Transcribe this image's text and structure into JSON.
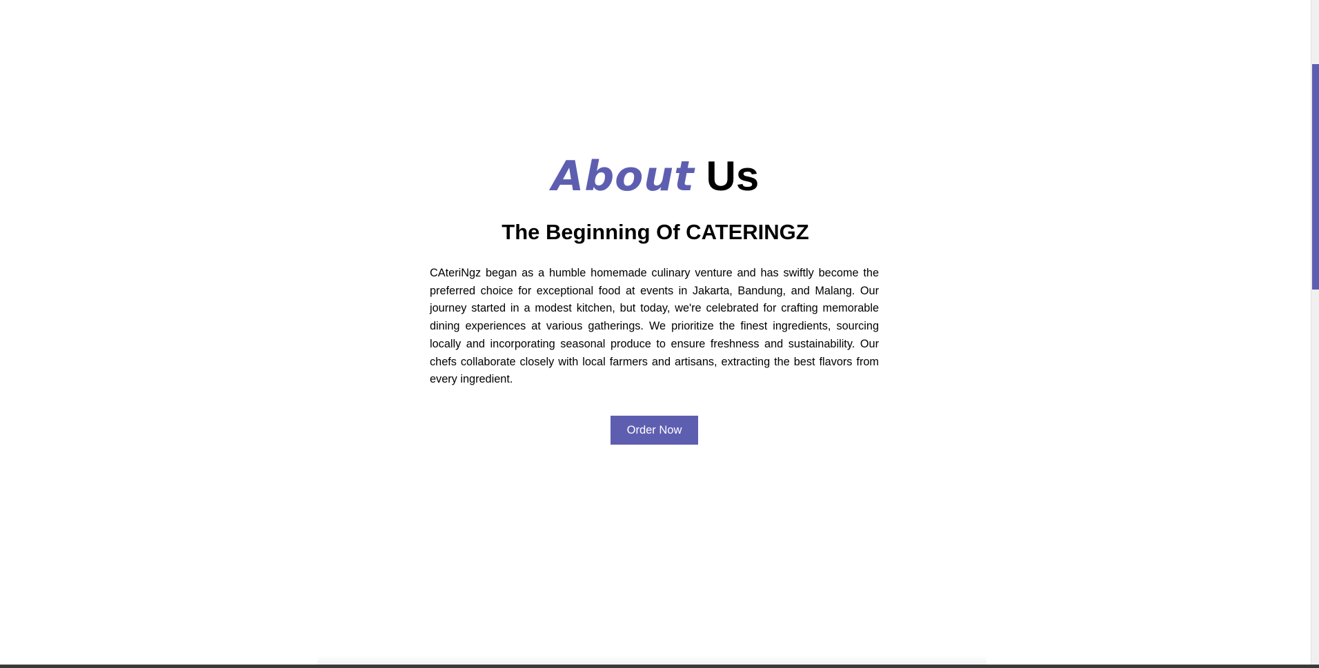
{
  "about": {
    "heading_accent": "About",
    "heading_rest": "Us",
    "subheading": "The Beginning Of CATERINGZ",
    "paragraph": "CAteriNgz began as a humble homemade culinary venture and has swiftly become the preferred choice for exceptional food at events in Jakarta, Bandung, and Malang. Our journey started in a modest kitchen, but today, we're celebrated for crafting memorable dining experiences at various gatherings. We prioritize the finest ingredients, sourcing locally and incorporating seasonal produce to ensure freshness and sustainability. Our chefs collaborate closely with local farmers and artisans, extracting the best flavors from every ingredient.",
    "order_button_label": "Order Now"
  },
  "colors": {
    "accent": "#5e5eb1",
    "text": "#000000",
    "background": "#ffffff"
  },
  "scrollbar": {
    "position_fraction": 0.09
  }
}
